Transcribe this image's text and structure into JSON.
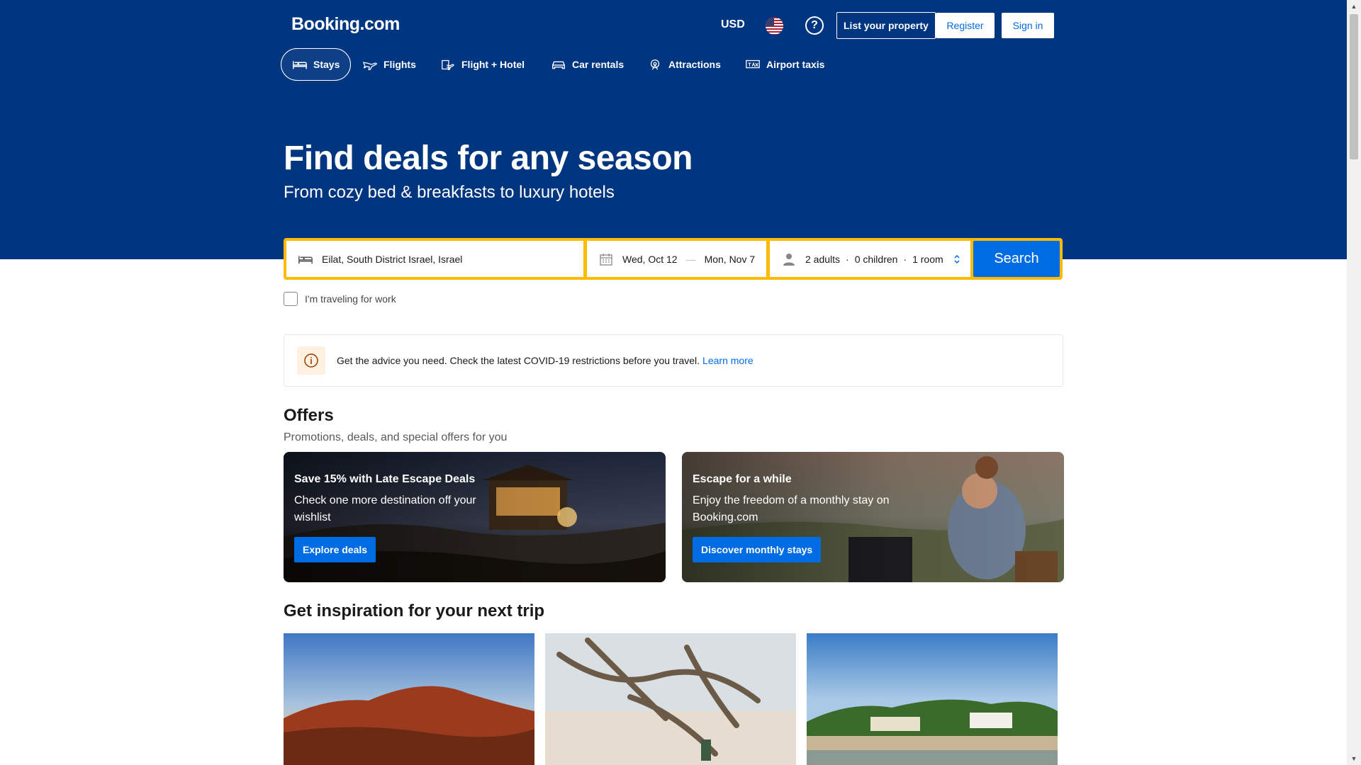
{
  "header": {
    "logo": "Booking.com",
    "currency": "USD",
    "list_property": "List your property",
    "register": "Register",
    "sign_in": "Sign in"
  },
  "nav": {
    "items": [
      {
        "label": "Stays",
        "icon": "bed-icon",
        "active": true
      },
      {
        "label": "Flights",
        "icon": "plane-icon"
      },
      {
        "label": "Flight + Hotel",
        "icon": "flight-hotel-icon"
      },
      {
        "label": "Car rentals",
        "icon": "car-icon"
      },
      {
        "label": "Attractions",
        "icon": "attractions-icon"
      },
      {
        "label": "Airport taxis",
        "icon": "taxi-icon"
      }
    ]
  },
  "hero": {
    "title": "Find deals for any season",
    "subtitle": "From cozy bed & breakfasts to luxury hotels"
  },
  "search": {
    "destination": "Eilat, South District Israel, Israel",
    "checkin": "Wed, Oct 12",
    "checkout": "Mon, Nov 7",
    "adults": "2 adults",
    "children": "0 children",
    "rooms": "1 room",
    "dot": "·",
    "dash": "—",
    "button": "Search",
    "work_label": "I'm traveling for work"
  },
  "notice": {
    "text": "Get the advice you need. Check the latest COVID-19 restrictions before you travel.",
    "link": "Learn more"
  },
  "offers": {
    "title": "Offers",
    "subtitle": "Promotions, deals, and special offers for you",
    "cards": [
      {
        "title": "Save 15% with Late Escape Deals",
        "desc": "Check one more destination off your wishlist",
        "button": "Explore deals"
      },
      {
        "title": "Escape for a while",
        "desc": "Enjoy the freedom of a monthly stay on Booking.com",
        "button": "Discover monthly stays"
      }
    ]
  },
  "inspiration": {
    "title": "Get inspiration for your next trip"
  },
  "colors": {
    "brand": "#003580",
    "accent": "#006ce4",
    "search_border": "#febb02"
  }
}
